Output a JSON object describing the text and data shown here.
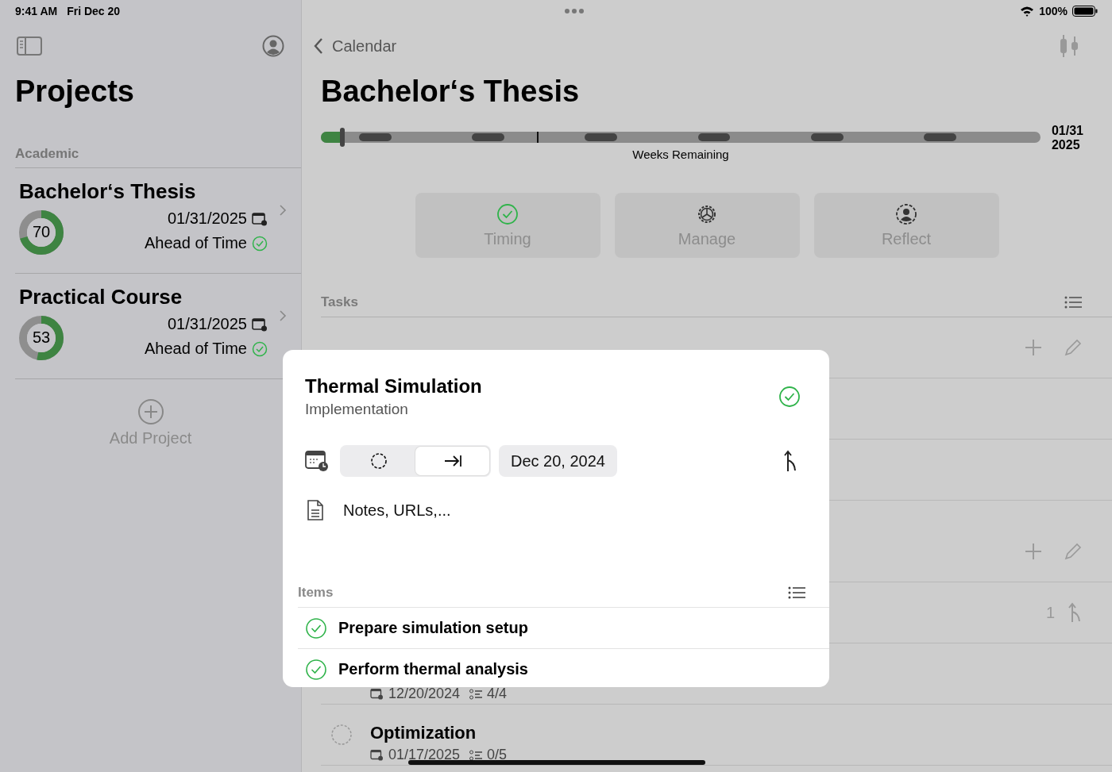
{
  "status_bar": {
    "time": "9:41 AM",
    "date": "Fri Dec 20",
    "battery": "100%"
  },
  "sidebar": {
    "title": "Projects",
    "section": "Academic",
    "projects": [
      {
        "name": "Bachelor‘s Thesis",
        "progress": "70",
        "level": 0.7,
        "due": "01/31/2025",
        "status": "Ahead of Time",
        "on_track": true
      },
      {
        "name": "Practical Course",
        "progress": "53",
        "level": 0.53,
        "due": "01/31/2025",
        "status": "Ahead of Time",
        "on_track": true
      }
    ],
    "add_button": "Add Project"
  },
  "detail": {
    "back": "Calendar",
    "title": "Bachelor‘s Thesis",
    "timeline": {
      "level": 0.03,
      "caption": "Weeks Remaining",
      "end_day": "01/31",
      "end_year": "2025"
    },
    "actions": [
      {
        "label": "Timing",
        "kind": "check"
      },
      {
        "label": "Manage",
        "kind": "gear"
      },
      {
        "label": "Reflect",
        "kind": "person"
      }
    ],
    "tasks_header": "Tasks",
    "task_rows": [
      {
        "kind": "group"
      },
      {
        "kind": "blank"
      },
      {
        "kind": "blank"
      },
      {
        "kind": "group"
      },
      {
        "kind": "linked",
        "count": "1"
      },
      {
        "kind": "task",
        "date": "12/20/2024",
        "items": "4/4"
      },
      {
        "kind": "task",
        "done": false,
        "title": "Optimization",
        "date": "01/17/2025",
        "items": "0/5"
      }
    ]
  },
  "sheet": {
    "title": "Thermal Simulation",
    "subtitle": "Implementation",
    "done": true,
    "segments": [
      {
        "kind": "circle",
        "selected": false
      },
      {
        "kind": "arrow",
        "selected": true
      }
    ],
    "date": "Dec 20, 2024",
    "notes_placeholder": "Notes, URLs,...",
    "items_header": "Items",
    "items": [
      {
        "text": "Prepare simulation setup",
        "done": true
      },
      {
        "text": "Perform thermal analysis",
        "done": true
      }
    ]
  }
}
